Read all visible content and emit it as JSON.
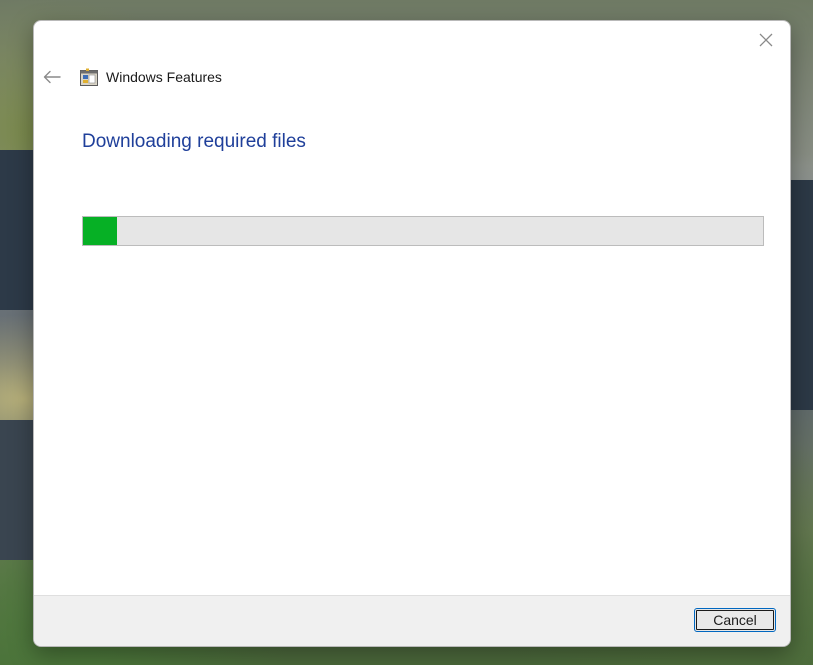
{
  "window": {
    "title": "Windows Features",
    "app_icon": "windows-features-icon",
    "close_icon": "close-icon",
    "back_icon": "back-arrow-icon"
  },
  "main": {
    "heading": "Downloading required files",
    "progress_percent": 5
  },
  "footer": {
    "cancel_label": "Cancel"
  },
  "colors": {
    "heading": "#1f3f9a",
    "progress_fill": "#06b025",
    "progress_track": "#e6e6e6"
  }
}
